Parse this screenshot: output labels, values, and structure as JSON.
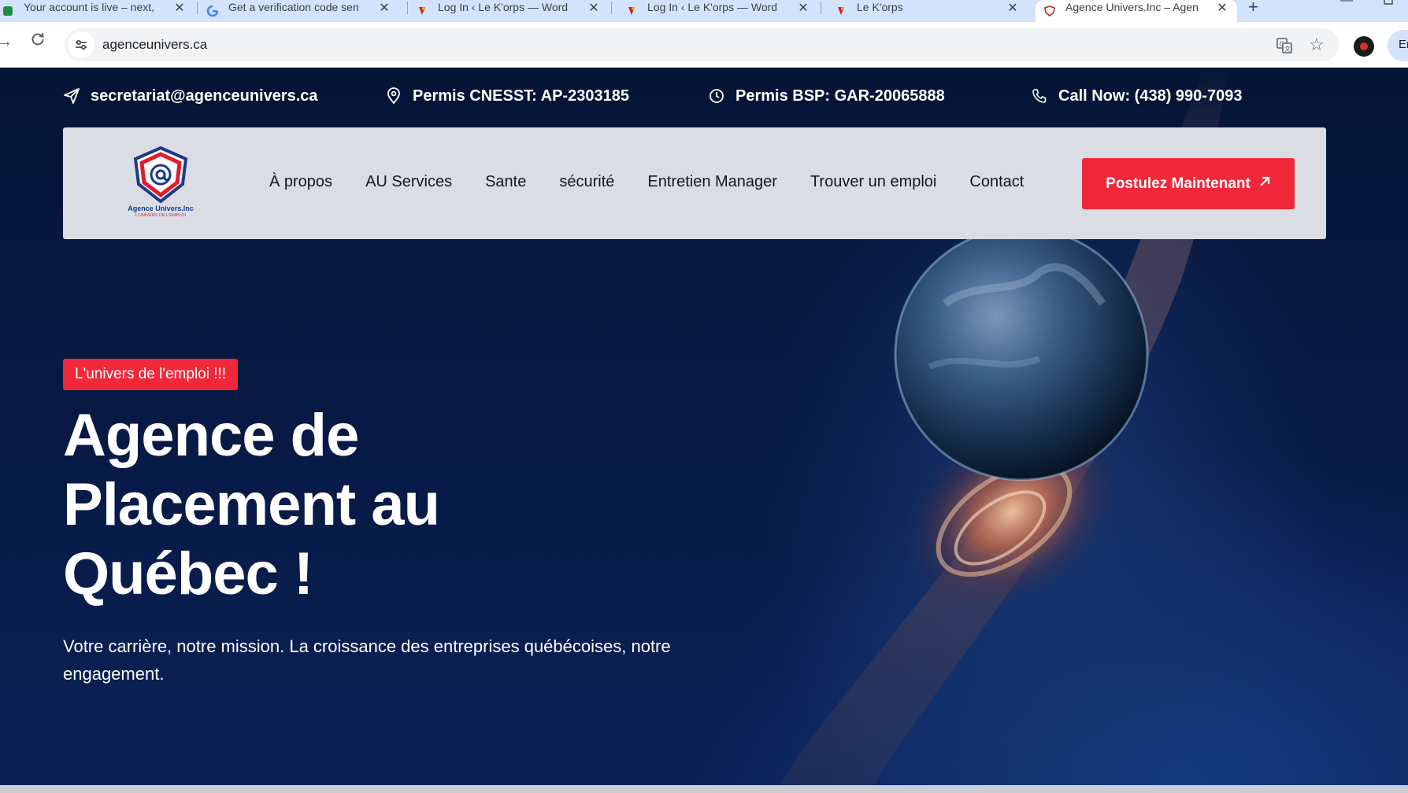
{
  "browser": {
    "tabs": [
      {
        "title": "Your account is live – next,",
        "favicon": "green-app-icon"
      },
      {
        "title": "Get a verification code sen",
        "favicon": "google-icon"
      },
      {
        "title": "Log In ‹ Le K'orps — Word",
        "favicon": "korps-icon"
      },
      {
        "title": "Log In ‹ Le K'orps — Word",
        "favicon": "korps-icon"
      },
      {
        "title": "Le K'orps",
        "favicon": "korps-icon"
      },
      {
        "title": "Agence Univers.Inc – Agen",
        "favicon": "agence-shield-icon",
        "active": true
      }
    ],
    "url": "agenceunivers.ca",
    "profile_pill": "Er"
  },
  "topbar": {
    "email": "secretariat@agenceunivers.ca",
    "cnesst": "Permis CNESST: AP-2303185",
    "bsp": "Permis BSP: GAR-20065888",
    "phone": "Call Now: (438) 990-7093"
  },
  "nav": {
    "logo_name": "Agence Univers.Inc",
    "logo_tagline": "L'UNIVERS DE L'EMPLOI",
    "items": [
      "À propos",
      "AU Services",
      "Sante",
      "sécurité",
      "Entretien Manager",
      "Trouver un emploi",
      "Contact"
    ],
    "cta": "Postulez Maintenant"
  },
  "hero": {
    "badge": "L'univers de l'emploi !!!",
    "title_line1": "Agence de",
    "title_line2": "Placement au",
    "title_line3": "Québec !",
    "subtitle": "Votre carrière, notre mission. La croissance des entreprises québécoises, notre engagement."
  },
  "colors": {
    "accent_red": "#f0283a",
    "page_navy": "#061536",
    "nav_bg": "#dadde4"
  }
}
